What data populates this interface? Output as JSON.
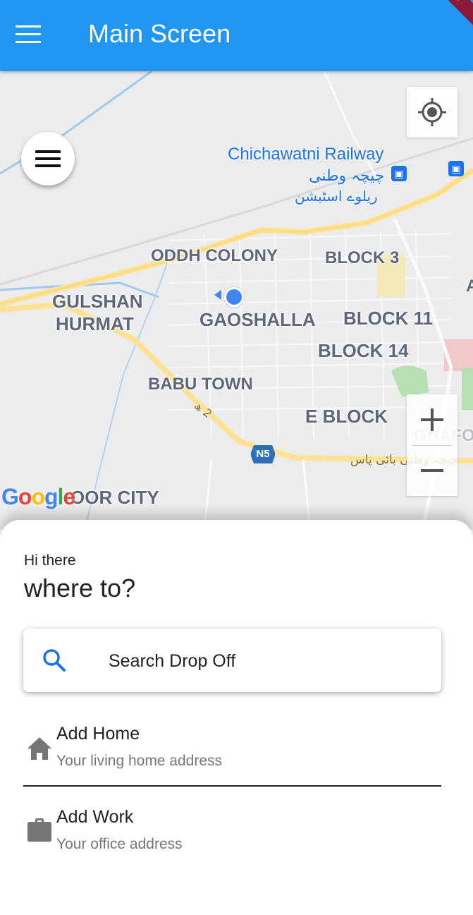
{
  "app_bar": {
    "title": "Main Screen",
    "menu_icon": "hamburger-menu-icon",
    "color": "#2196F3",
    "debug_banner": "G"
  },
  "map": {
    "pois": [
      {
        "name": "Chichawatni Railway",
        "urdu_line1": "چیچہ وطنی",
        "urdu_line2": "ریلوے اسٹیشن"
      }
    ],
    "areas": {
      "oddh_colony": "ODDH COLONY",
      "block3": "BLOCK 3",
      "gulshan1": "GULSHAN",
      "gulshan2": "HURMAT",
      "gaoshalla": "GAOSHALLA",
      "block11": "BLOCK 11",
      "block14": "BLOCK 14",
      "babu_town": "BABU TOWN",
      "e_block": "E BLOCK",
      "ghafo": "GHAFO",
      "noor_city": "OOR CITY",
      "edge_a": "A"
    },
    "road_labels": {
      "n5": "N5",
      "urdu_bypass": "چیچہ وطنی بائی پاس",
      "road2": "2 ھ"
    },
    "google_logo": {
      "letters": [
        "G",
        "o",
        "o",
        "g",
        "l",
        "e"
      ],
      "colors": [
        "#4285F4",
        "#EA4335",
        "#FBBC05",
        "#4285F4",
        "#34A853",
        "#EA4335"
      ]
    },
    "controls": {
      "my_location_icon": "my-location-icon",
      "zoom_in_icon": "plus-icon",
      "zoom_out_icon": "minus-icon",
      "drawer_icon": "hamburger-menu-icon"
    }
  },
  "sheet": {
    "greeting": "Hi there",
    "question": "where to?",
    "search": {
      "placeholder": "Search Drop Off",
      "icon": "search-icon"
    },
    "items": [
      {
        "title": "Add Home",
        "subtitle": "Your living home address",
        "icon": "home-icon"
      },
      {
        "title": "Add Work",
        "subtitle": "Your office address",
        "icon": "work-briefcase-icon"
      }
    ]
  }
}
